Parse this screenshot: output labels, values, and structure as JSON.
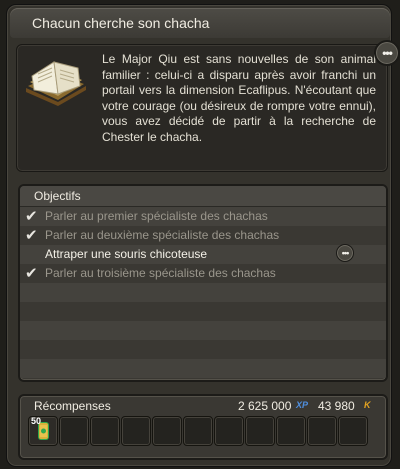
{
  "quest": {
    "title": "Chacun cherche son chacha",
    "description": "Le Major Qiu est sans nouvelles de son animal familier : celui-ci a disparu après avoir franchi un portail vers la dimension Ecaflipus. N'écoutant que votre courage (ou désireux de rompre votre ennui), vous avez décidé de partir à la recherche de Chester le chacha."
  },
  "objectives": {
    "header": "Objectifs",
    "items": [
      {
        "label": "Parler au premier spécialiste des chachas",
        "done": true
      },
      {
        "label": "Parler au deuxième spécialiste des chachas",
        "done": true
      },
      {
        "label": "Attraper une souris chicoteuse",
        "done": false
      },
      {
        "label": "Parler au troisième spécialiste des chachas",
        "done": true
      }
    ]
  },
  "rewards": {
    "header": "Récompenses",
    "xp": "2 625 000",
    "xp_tag": "XP",
    "kamas": "43 980",
    "kamas_tag": "K",
    "item_qty": "50",
    "slot_count": 10
  },
  "colors": {
    "xp": "#4f8fe0",
    "kamas": "#e3a321"
  },
  "icons": {
    "quest": "book-icon",
    "more": "more-dots-icon",
    "done": "check-icon",
    "reward_item": "candy-icon"
  }
}
